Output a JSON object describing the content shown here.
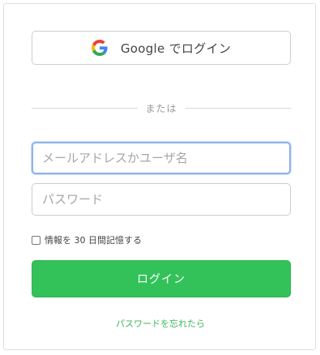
{
  "google_button": {
    "label": "Google でログイン"
  },
  "divider": {
    "text": "または"
  },
  "username": {
    "placeholder": "メールアドレスかユーザ名",
    "value": ""
  },
  "password": {
    "placeholder": "パスワード",
    "value": ""
  },
  "remember": {
    "label": "情報を 30 日間記憶する",
    "checked": false
  },
  "login_button": {
    "label": "ログイン"
  },
  "forgot_password": {
    "label": "パスワードを忘れたら"
  },
  "colors": {
    "primary_green": "#33c25a",
    "link_green": "#3bb55c",
    "focus_blue": "#8fb4e8"
  }
}
